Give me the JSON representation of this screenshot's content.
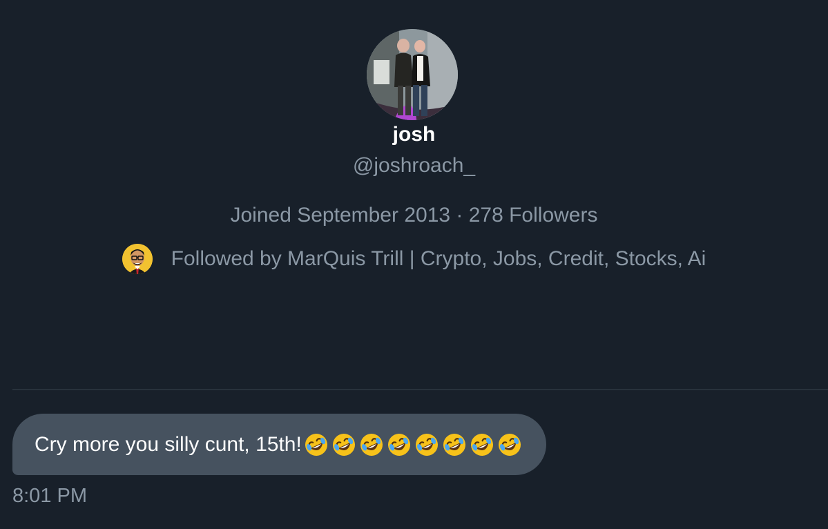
{
  "profile": {
    "display_name": "josh",
    "handle": "@joshroach_",
    "meta": "Joined September 2013 · 278 Followers",
    "followed_by": "Followed by MarQuis Trill | Crypto, Jobs, Credit, Stocks, Ai",
    "avatar_icon": "profile-photo-two-men",
    "follower_avatar_icon": "cartoon-man-avatar"
  },
  "message": {
    "text": "Cry more you silly cunt, 15th!",
    "emoji": [
      "rolling-on-floor-laughing-icon",
      "rolling-on-floor-laughing-icon",
      "rolling-on-floor-laughing-icon",
      "rolling-on-floor-laughing-icon",
      "rolling-on-floor-laughing-icon",
      "rolling-on-floor-laughing-icon",
      "rolling-on-floor-laughing-icon",
      "rolling-on-floor-laughing-icon"
    ],
    "timestamp": "8:01 PM"
  },
  "colors": {
    "background": "#18202a",
    "bubble": "#46525f",
    "secondary_text": "#8b98a5",
    "divider": "#38444d"
  }
}
